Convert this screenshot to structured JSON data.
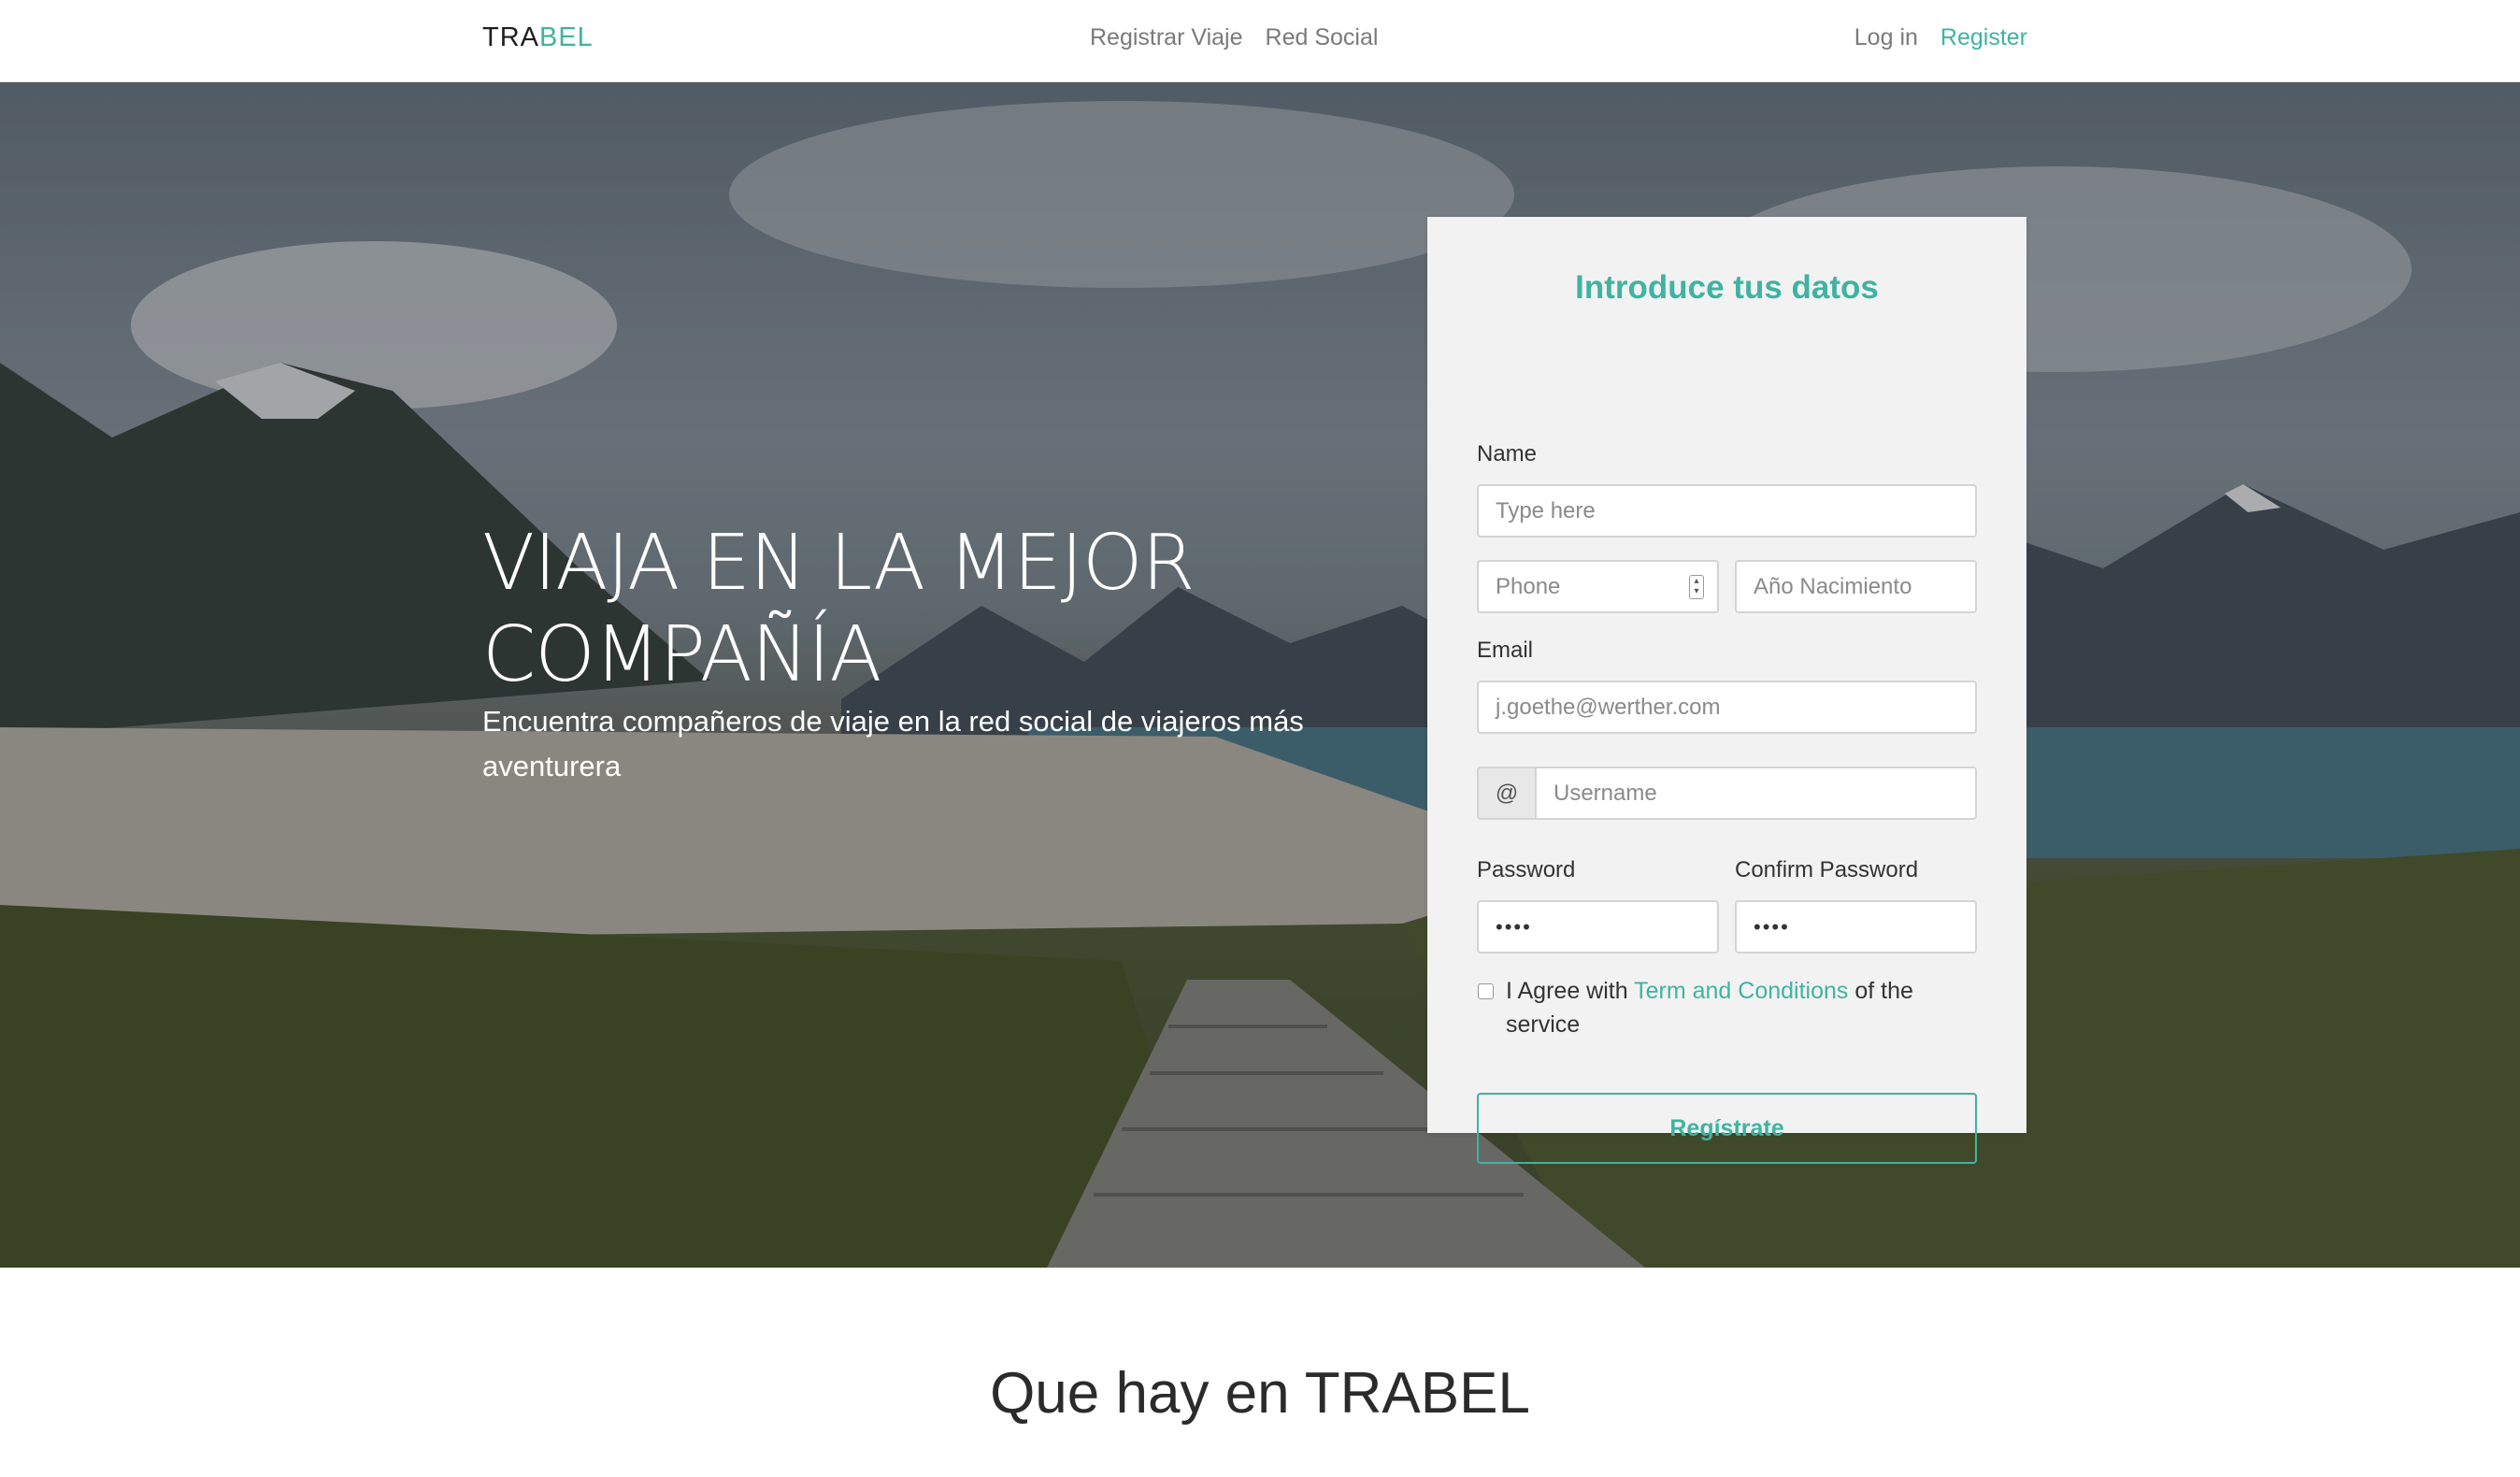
{
  "navbar": {
    "brand_part1": "TRA",
    "brand_part2": "BEL",
    "center_links": [
      "Registrar Viaje",
      "Red Social"
    ],
    "login": "Log in",
    "register": "Register"
  },
  "hero": {
    "title": "VIAJA EN LA MEJOR COMPAÑÍA",
    "subtitle": "Encuentra compañeros de viaje en la red social de viajeros más aventurera"
  },
  "form": {
    "title": "Introduce tus datos",
    "name_label": "Name",
    "name_placeholder": "Type here",
    "phone_placeholder": "Phone",
    "birth_placeholder": "Año Nacimiento",
    "email_label": "Email",
    "email_placeholder": "j.goethe@werther.com",
    "username_addon": "@",
    "username_placeholder": "Username",
    "password_label": "Password",
    "password_value": "••••",
    "confirm_label": "Confirm Password",
    "confirm_value": "••••",
    "agree_prefix": "I Agree with ",
    "agree_link": "Term and Conditions",
    "agree_suffix": " of the service",
    "submit": "Regístrate"
  },
  "section": {
    "title": "Que hay en TRABEL"
  },
  "colors": {
    "accent": "#3fb3a1"
  }
}
